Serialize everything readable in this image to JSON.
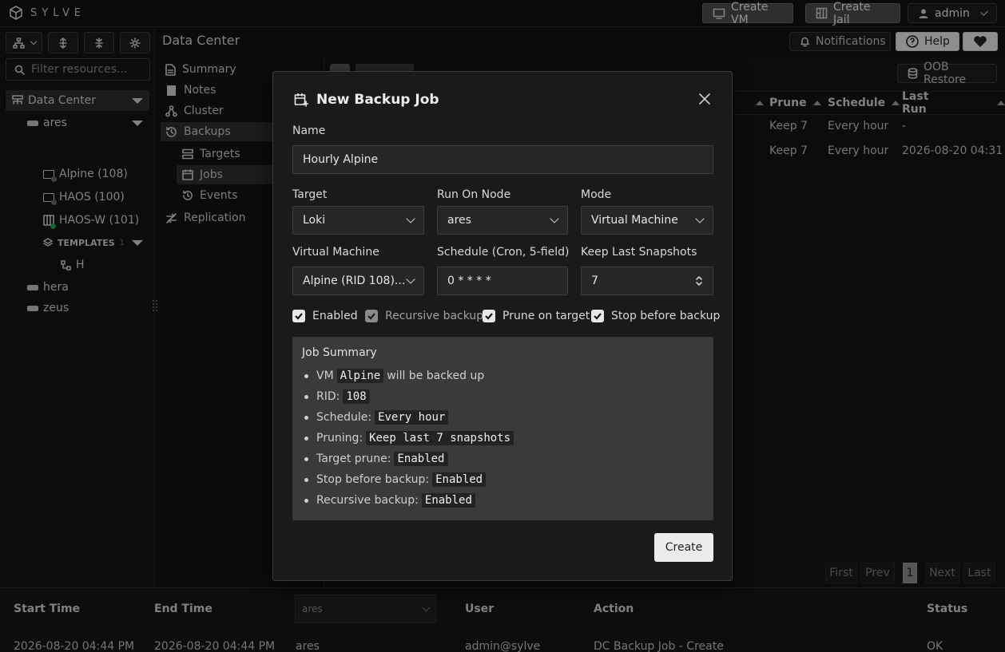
{
  "brand": "SYLVE",
  "topbar": {
    "create_vm": "Create VM",
    "create_jail": "Create Jail",
    "user": "admin"
  },
  "left": {
    "filter_placeholder": "Filter resources...",
    "tree": {
      "datacenter": "Data Center",
      "node_ares": "ares",
      "vm1": "Alpine (108)",
      "vm2": "HAOS (100)",
      "vm3": "HAOS-W (101)",
      "templates": "TEMPLATES",
      "templates_count": "1",
      "template_h": "H",
      "node_hera": "hera",
      "node_zeus": "zeus"
    }
  },
  "middle": {
    "title": "Data Center",
    "nav": [
      "Summary",
      "Notes",
      "Cluster",
      "Backups",
      "Targets",
      "Jobs",
      "Events",
      "Replication"
    ]
  },
  "right": {
    "notifications": "Notifications",
    "help": "Help",
    "oob_restore": "OOB Restore",
    "columns": [
      "Prune",
      "Schedule",
      "Last Run"
    ],
    "rows": [
      {
        "prune": "Keep 7",
        "schedule": "Every hour",
        "last_run": "-"
      },
      {
        "prune": "Keep 7",
        "schedule": "Every hour",
        "last_run": "2026-08-20 04:31 PM"
      }
    ],
    "pagination": {
      "first": "First",
      "prev": "Prev",
      "page": "1",
      "next": "Next",
      "last": "Last"
    }
  },
  "bottom": {
    "columns": {
      "start": "Start Time",
      "end": "End Time",
      "node_select": "ares",
      "user": "User",
      "action": "Action",
      "status": "Status"
    },
    "row": {
      "start": "2026-08-20 04:44 PM",
      "end": "2026-08-20 04:44 PM",
      "node": "ares",
      "user": "admin@sylve",
      "action": "DC Backup Job - Create",
      "status": "OK"
    }
  },
  "modal": {
    "title": "New Backup Job",
    "name_label": "Name",
    "name_value": "Hourly Alpine",
    "target_label": "Target",
    "target_value": "Loki",
    "node_label": "Run On Node",
    "node_value": "ares",
    "mode_label": "Mode",
    "mode_value": "Virtual Machine",
    "vm_label": "Virtual Machine",
    "vm_value": "Alpine (RID 108)...",
    "schedule_label": "Schedule (Cron, 5-field)",
    "schedule_value": "0 * * * *",
    "keep_label": "Keep Last Snapshots",
    "keep_value": "7",
    "checks": {
      "enabled": "Enabled",
      "recursive": "Recursive backup",
      "prune": "Prune on target",
      "stop": "Stop before backup"
    },
    "summary": {
      "title": "Job Summary",
      "vm_pre": "VM",
      "vm_code": "Alpine",
      "vm_post": "will be backed up",
      "rid_pre": "RID:",
      "rid_code": "108",
      "sched_pre": "Schedule:",
      "sched_code": "Every hour",
      "prune_pre": "Pruning:",
      "prune_code": "Keep last 7 snapshots",
      "tprune_pre": "Target prune:",
      "tprune_code": "Enabled",
      "stop_pre": "Stop before backup:",
      "stop_code": "Enabled",
      "rec_pre": "Recursive backup:",
      "rec_code": "Enabled"
    },
    "create": "Create"
  }
}
